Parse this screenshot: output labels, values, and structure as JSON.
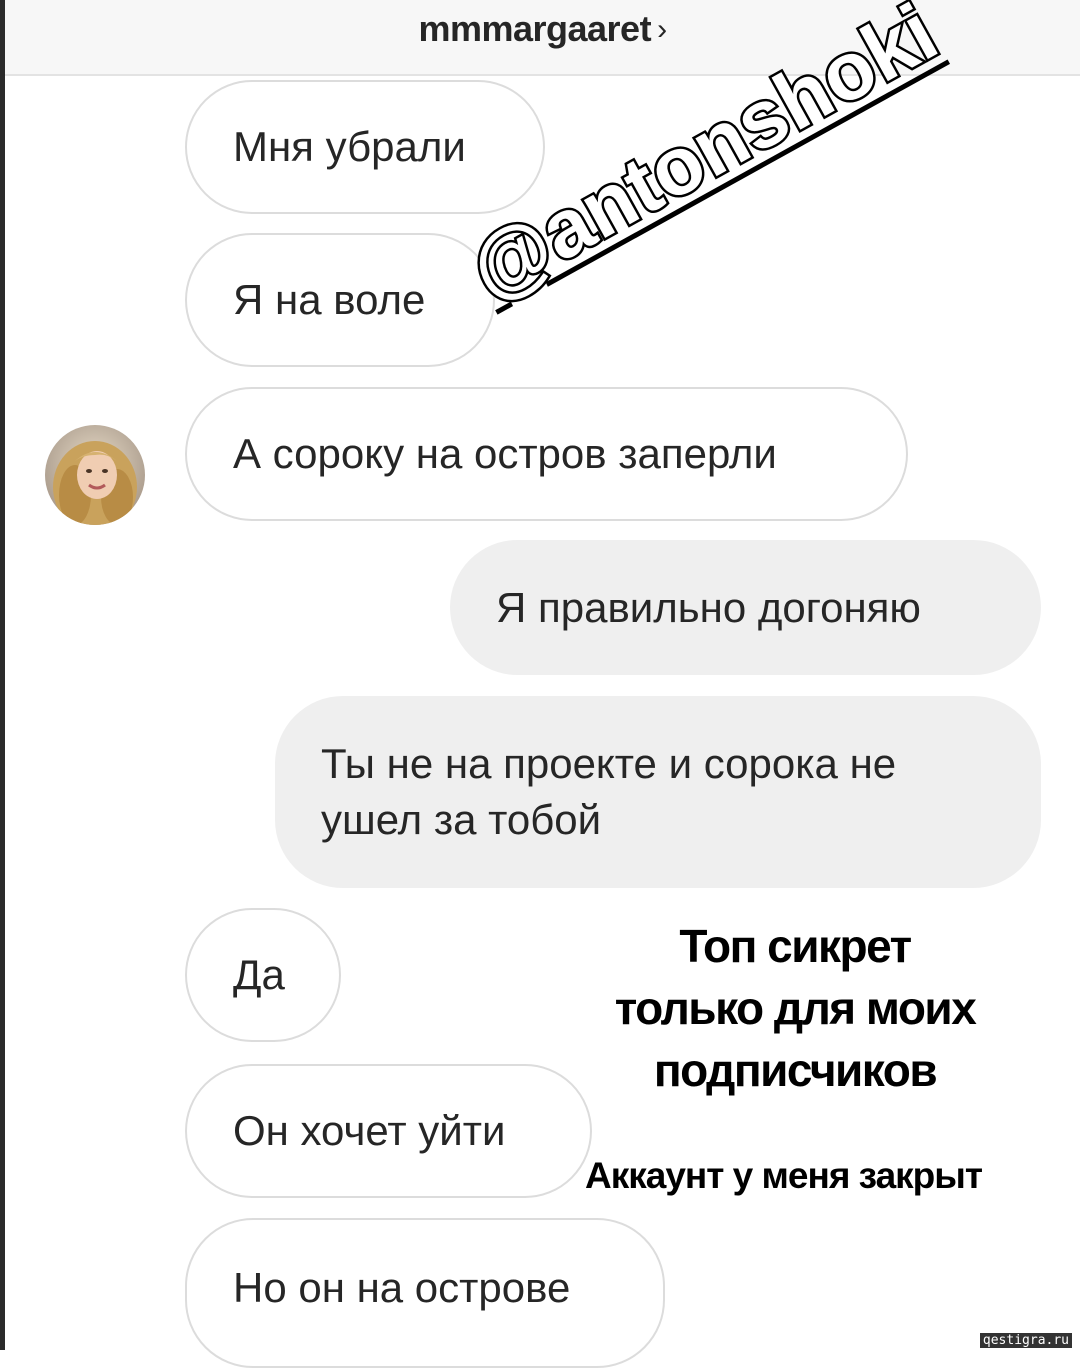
{
  "header": {
    "title": "mmmargaaret",
    "chevron": "›"
  },
  "messages": [
    {
      "direction": "in",
      "text": "Мня убрали"
    },
    {
      "direction": "in",
      "text": "Я на воле"
    },
    {
      "direction": "in",
      "text": "А сороку на остров заперли"
    },
    {
      "direction": "out",
      "text": "Я правильно догоняю"
    },
    {
      "direction": "out",
      "line1": "Ты не на проекте и сорока не",
      "line2": "ушел за тобой"
    },
    {
      "direction": "in",
      "text": "Да"
    },
    {
      "direction": "in",
      "text": "Он хочет уйти"
    },
    {
      "direction": "in",
      "text": "Но он на острове"
    }
  ],
  "overlay": {
    "watermark": "@antonshoki",
    "promo_line1": "Топ сикрет",
    "promo_line2": "только для моих",
    "promo_line3": "подписчиков",
    "promo_sub": "Аккаунт у меня закрыт",
    "source": "qestigra.ru"
  },
  "colors": {
    "incoming_bubble_bg": "#ffffff",
    "incoming_bubble_border": "#dcdcdc",
    "outgoing_bubble_bg": "#efefef",
    "header_bg": "#f7f7f7",
    "text": "#262626"
  },
  "icons": {
    "header_chevron": "chevron-right-icon",
    "avatar": "profile-avatar"
  }
}
